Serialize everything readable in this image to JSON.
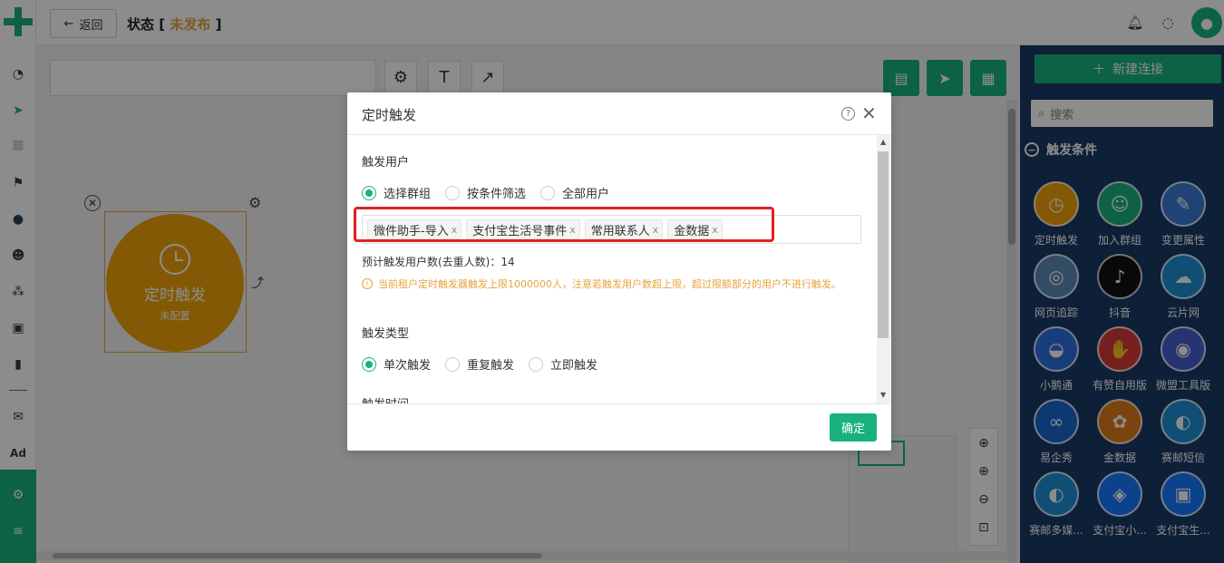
{
  "topbar": {
    "back_label": "返回",
    "title_prefix": "状态",
    "bracket_open": "[",
    "status": "未发布",
    "bracket_close": "]"
  },
  "node": {
    "title": "定时触发",
    "subtitle": "未配置"
  },
  "right_panel": {
    "new_link_label": "新建连接",
    "search_placeholder": "搜索",
    "section_title": "触发条件",
    "tiles": [
      {
        "label": "定时触发",
        "icon": "clock-icon",
        "color": "#f0a30a"
      },
      {
        "label": "加入群组",
        "icon": "add-user-icon",
        "color": "#18b27f"
      },
      {
        "label": "变更属性",
        "icon": "edit-icon",
        "color": "#3a7bd5"
      },
      {
        "label": "网页追踪",
        "icon": "web-track-icon",
        "color": "#5b8bb7"
      },
      {
        "label": "抖音",
        "icon": "tiktok-icon",
        "color": "#111111"
      },
      {
        "label": "云片网",
        "icon": "cloud-icon",
        "color": "#1e90d6"
      },
      {
        "label": "小鹅通",
        "icon": "xiaoe-icon",
        "color": "#2f6fe0"
      },
      {
        "label": "有赞自用版",
        "icon": "thumb-icon",
        "color": "#d93a3a"
      },
      {
        "label": "微盟工具版",
        "icon": "weimob-icon",
        "color": "#4a5fd0"
      },
      {
        "label": "易企秀",
        "icon": "eqxiu-icon",
        "color": "#1a67d0"
      },
      {
        "label": "金数据",
        "icon": "jinshuju-icon",
        "color": "#e07a1a"
      },
      {
        "label": "赛邮短信",
        "icon": "submail-icon",
        "color": "#1e8fd6"
      },
      {
        "label": "赛邮多媒...",
        "icon": "submail-media-icon",
        "color": "#1e8fd6"
      },
      {
        "label": "支付宝小...",
        "icon": "alipay-mini-icon",
        "color": "#1677ff"
      },
      {
        "label": "支付宝生...",
        "icon": "alipay-life-icon",
        "color": "#1677ff"
      }
    ]
  },
  "dialog": {
    "title": "定时触发",
    "help_label": "?",
    "close_label": "✕",
    "trigger_user_label": "触发用户",
    "user_options": [
      {
        "label": "选择群组",
        "checked": true
      },
      {
        "label": "按条件筛选",
        "checked": false
      },
      {
        "label": "全部用户",
        "checked": false
      }
    ],
    "tags": [
      "微件助手-导入",
      "支付宝生活号事件",
      "常用联系人",
      "金数据"
    ],
    "tag_remove": "x",
    "estimate_label": "预计触发用户数(去重人数)：14",
    "warning": "当前租户定时触发器触发上限1000000人，注意若触发用户数超上限，超过限额部分的用户不进行触发。",
    "trigger_type_label": "触发类型",
    "type_options": [
      {
        "label": "单次触发",
        "checked": true
      },
      {
        "label": "重复触发",
        "checked": false
      },
      {
        "label": "立即触发",
        "checked": false
      }
    ],
    "trigger_time_label": "触发时间",
    "confirm_label": "确定"
  },
  "colors": {
    "accent": "#18b27f",
    "warning": "#e8a33d",
    "node": "#f0a30a",
    "panel": "#1a3a66",
    "highlight": "#e02020"
  }
}
